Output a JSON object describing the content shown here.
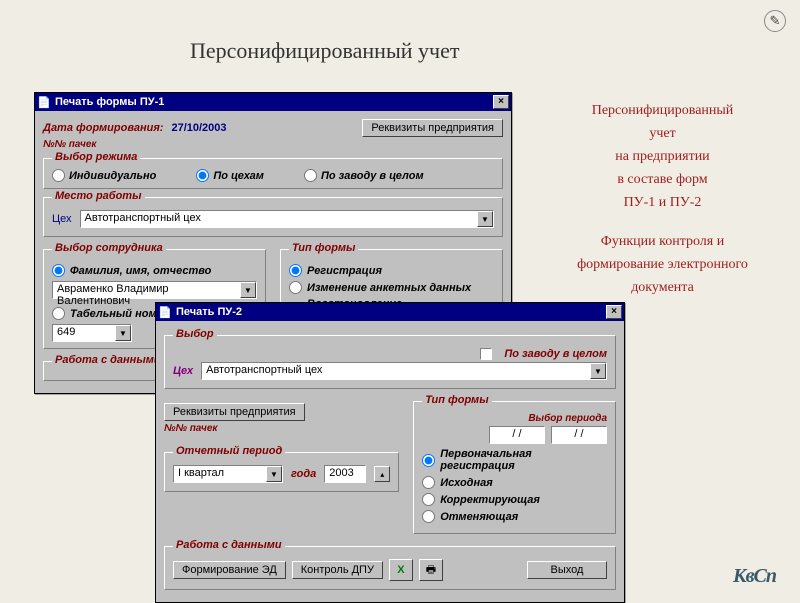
{
  "slide": {
    "title": "Персонифицированный учет"
  },
  "side": {
    "l1": "Персонифицированный",
    "l2": "учет",
    "l3": "на предприятии",
    "l4": "в составе форм",
    "l5": "ПУ-1 и ПУ-2",
    "l6": "Функции контроля и",
    "l7": "формирование электронного",
    "l8": "документа"
  },
  "win1": {
    "title": "Печать формы ПУ-1",
    "date_label": "Дата формирования:",
    "date_value": "27/10/2003",
    "packs_label": "№№ пачек",
    "btn_requisites": "Реквизиты предприятия",
    "group_mode": "Выбор режима",
    "mode_individual": "Индивидуально",
    "mode_by_shop": "По цехам",
    "mode_whole": "По заводу в целом",
    "group_place": "Место работы",
    "shop_label": "Цех",
    "shop_value": "Автотранспортный цех",
    "group_employee": "Выбор сотрудника",
    "emp_fio_label": "Фамилия, имя, отчество",
    "emp_fio_value": "Авраменко Владимир Валентинович",
    "emp_tab_label": "Табельный номер",
    "emp_tab_value": "649",
    "group_formtype": "Тип формы",
    "ft_reg": "Регистрация",
    "ft_change": "Изменение анкетных данных",
    "ft_restore": "Восстановление свидетельства социального страхования",
    "group_workdata": "Работа с данными"
  },
  "win2": {
    "title": "Печать ПУ-2",
    "group_select": "Выбор",
    "whole_factory": "По заводу в целом",
    "shop_label": "Цех",
    "shop_value": "Автотранспортный цех",
    "btn_requisites": "Реквизиты предприятия",
    "packs_label": "№№ пачек",
    "group_period": "Отчетный период",
    "period_value": "I квартал",
    "year_label": "года",
    "year_value": "2003",
    "group_formtype": "Тип формы",
    "period_sel_label": "Выбор периода",
    "period_from": "/ /",
    "period_to": "/ /",
    "ft_initial": "Первоначальная регистрация",
    "ft_source": "Исходная",
    "ft_correcting": "Корректирующая",
    "ft_cancel": "Отменяющая",
    "group_workdata": "Работа с данными",
    "btn_form_ed": "Формирование ЭД",
    "btn_control": "Контроль ДПУ",
    "btn_exit": "Выход"
  },
  "logo": "КвСп"
}
